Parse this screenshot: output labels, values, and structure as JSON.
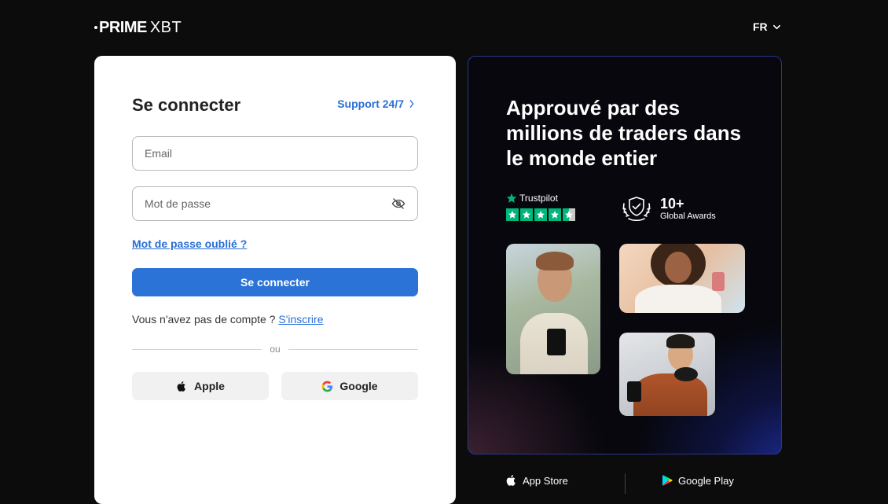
{
  "header": {
    "logo_prime": "PRIME",
    "logo_xbt": "XBT",
    "language": "FR"
  },
  "login": {
    "title": "Se connecter",
    "support_label": "Support 24/7",
    "email_placeholder": "Email",
    "password_placeholder": "Mot de passe",
    "forgot_label": "Mot de passe oublié ?",
    "submit_label": "Se connecter",
    "no_account_text": "Vous n'avez pas de compte ?",
    "signup_label": "S'inscrire",
    "divider_text": "ou",
    "apple_label": "Apple",
    "google_label": "Google"
  },
  "promo": {
    "title": "Approuvé par des millions de traders dans le monde entier",
    "trustpilot_label": "Trustpilot",
    "trustpilot_rating": 4.5,
    "awards_count": "10+",
    "awards_label": "Global Awards"
  },
  "apps": {
    "app_store_label": "App Store",
    "google_play_label": "Google Play"
  },
  "colors": {
    "accent": "#2b73d6",
    "link": "#2a6fd6",
    "trustpilot_green": "#00b67a",
    "background": "#0c0c0c"
  }
}
